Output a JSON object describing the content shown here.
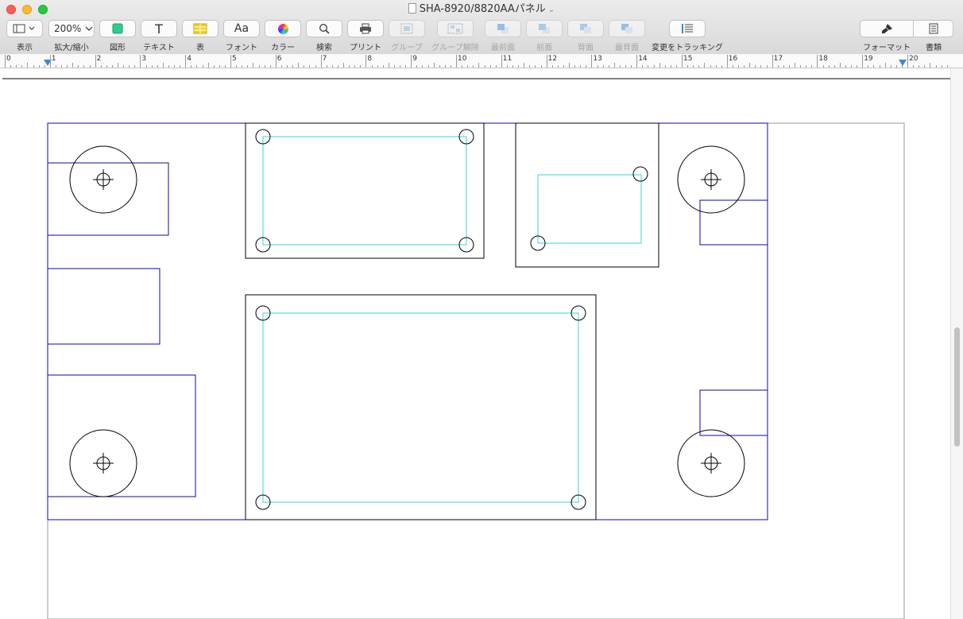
{
  "window": {
    "title": "SHA-8920/8820AAパネル"
  },
  "toolbar": {
    "view": {
      "label": "表示",
      "icon": "sidebar-layout-icon"
    },
    "zoom": {
      "label": "拡大/縮小",
      "value": "200%"
    },
    "shape": {
      "label": "図形",
      "icon": "shape-square-icon",
      "color": "#2ecc8f"
    },
    "text": {
      "label": "テキスト",
      "glyph": "T"
    },
    "table": {
      "label": "表",
      "icon": "table-icon",
      "color": "#f4d21d"
    },
    "font": {
      "label": "フォント",
      "glyph": "Aa"
    },
    "color": {
      "label": "カラー",
      "icon": "color-wheel-icon"
    },
    "search": {
      "label": "検索",
      "icon": "magnifier-icon"
    },
    "print": {
      "label": "プリント",
      "icon": "printer-icon"
    },
    "group": {
      "label": "グループ"
    },
    "ungroup": {
      "label": "グループ解除"
    },
    "front_most": {
      "label": "最前面"
    },
    "front": {
      "label": "前面"
    },
    "back": {
      "label": "背面"
    },
    "back_most": {
      "label": "最背面"
    },
    "track_changes": {
      "label": "変更をトラッキング"
    },
    "format": {
      "label": "フォーマット",
      "icon": "paintbrush-icon"
    },
    "document": {
      "label": "書類",
      "icon": "document-icon"
    }
  },
  "ruler": {
    "numbers": [
      "0",
      "1",
      "2",
      "3",
      "4",
      "5",
      "6",
      "7",
      "8",
      "9",
      "10",
      "11",
      "12",
      "13",
      "14",
      "15",
      "16",
      "17",
      "18",
      "19",
      "20"
    ]
  },
  "drawing": {
    "outline_color": "#0a0aa8",
    "part_color": "#000000",
    "inner_color": "#38d6d6"
  }
}
